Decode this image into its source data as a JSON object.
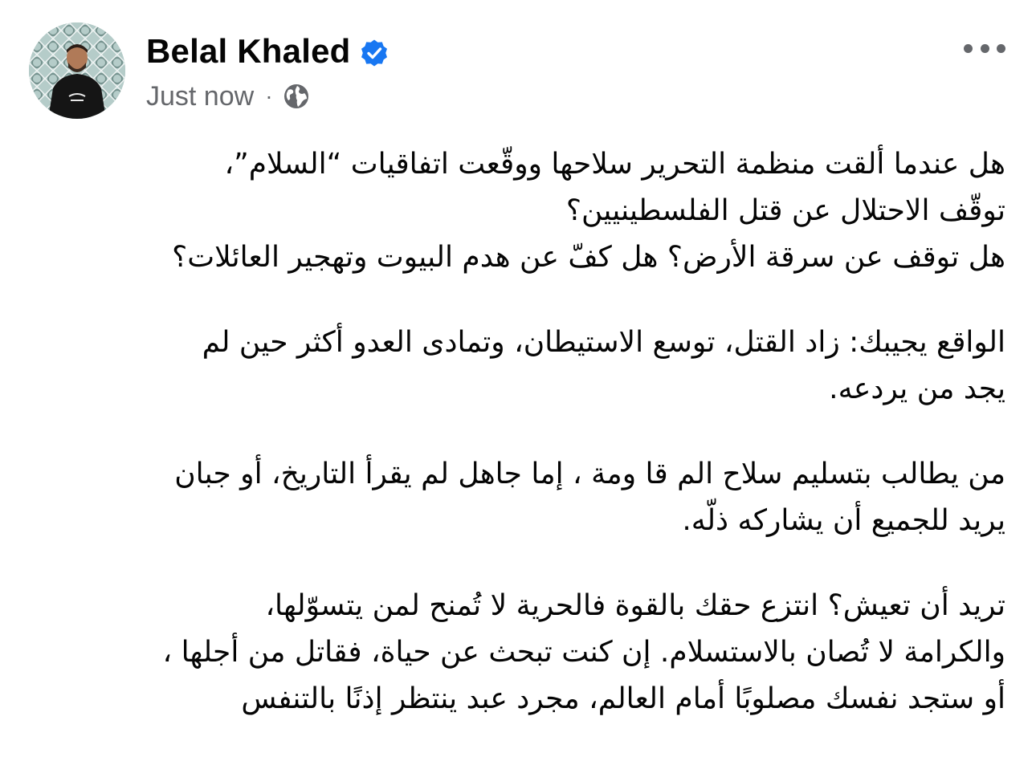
{
  "post": {
    "author": {
      "name": "Belal Khaled",
      "verified": true,
      "avatar_icon": "profile-photo"
    },
    "timestamp": "Just now",
    "separator": "·",
    "audience_icon": "globe-icon",
    "more_icon": "more-options-icon",
    "paragraphs": [
      {
        "lines": [
          "هل عندما ألقت منظمة التحرير سلاحها ووقّعت اتفاقيات “السلام”،",
          "توقّف الاحتلال عن قتل الفلسطينيين؟",
          "هل توقف عن سرقة الأرض؟ هل كفّ عن هدم البيوت وتهجير العائلات؟"
        ]
      },
      {
        "lines": [
          "الواقع يجيبك: زاد القتل، توسع الاستيطان، وتمادى العدو أكثر حين لم",
          "يجد من يردعه."
        ]
      },
      {
        "lines": [
          "من يطالب بتسليم سلاح الم قا ومة ، إما جاهل لم يقرأ التاريخ، أو جبان",
          "يريد للجميع أن يشاركه ذلّه."
        ]
      },
      {
        "lines": [
          "تريد أن تعيش؟ انتزع حقك بالقوة فالحرية لا تُمنح لمن يتسوّلها،",
          "والكرامة لا تُصان بالاستسلام. إن كنت تبحث عن حياة، فقاتل من أجلها ،",
          "أو ستجد نفسك مصلوبًا أمام العالم، مجرد عبد ينتظر إذنًا بالتنفس"
        ]
      }
    ]
  },
  "colors": {
    "text_primary": "#050505",
    "text_secondary": "#65676b",
    "verified_blue": "#1877f2"
  }
}
